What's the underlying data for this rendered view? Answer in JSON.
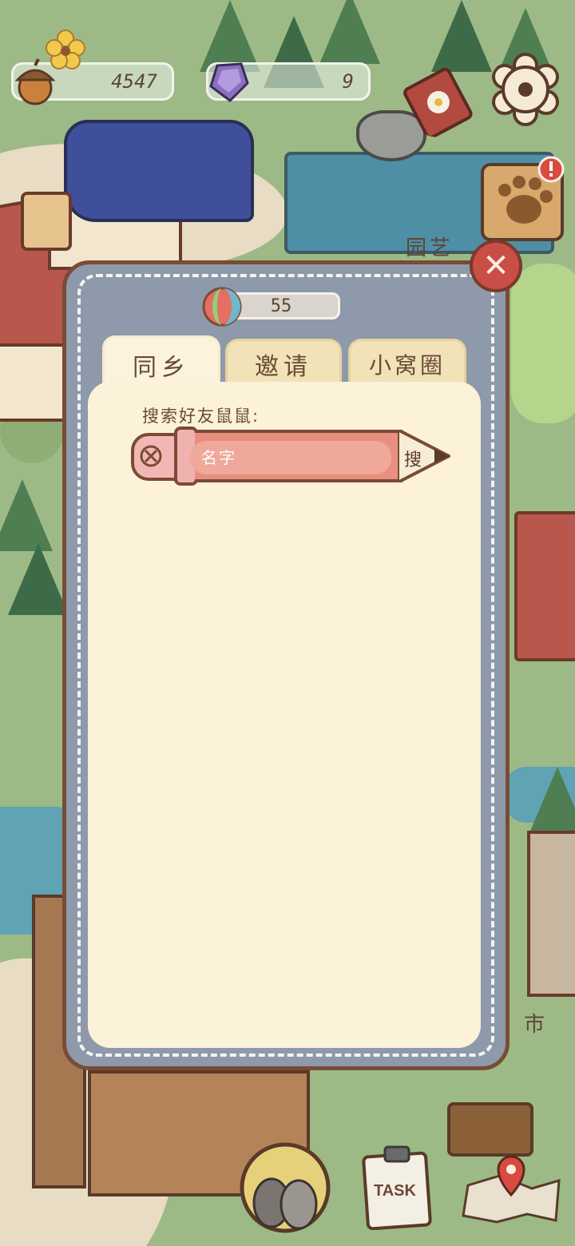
{
  "hud": {
    "acorns": "4547",
    "gems": "9"
  },
  "map_labels": {
    "garden": "园艺",
    "market": "市"
  },
  "dialog": {
    "counter": "55",
    "tabs": [
      {
        "label": "同乡",
        "active": true
      },
      {
        "label": "邀请",
        "active": false
      },
      {
        "label": "小窝圈",
        "active": false
      }
    ],
    "search_label": "搜索好友鼠鼠:",
    "search_placeholder": "名字",
    "search_button": "搜"
  },
  "bottom": {
    "task_label": "TASK"
  },
  "icons": {
    "acorn": "acorn-icon",
    "gem": "gem-icon",
    "flower": "flower-icon",
    "cookbook": "book-icon",
    "settings": "gear-icon",
    "paw": "paw-icon",
    "close": "close-icon",
    "ball": "yarn-ball-icon",
    "clear": "clear-icon",
    "friends": "mice-avatar-icon",
    "task": "clipboard-icon",
    "map": "map-pin-icon"
  },
  "colors": {
    "dialog_frame": "#8e99ab",
    "panel": "#fbf2d9",
    "tab": "#f1e2b7",
    "close": "#c94e45",
    "pencil": "#e98f7f",
    "text": "#6a4a36"
  }
}
